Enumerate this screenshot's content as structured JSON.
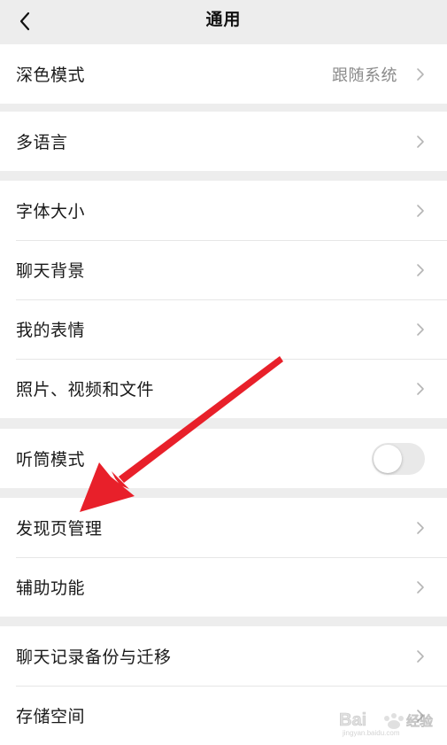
{
  "header": {
    "title": "通用",
    "back_icon": "chevron-left-icon"
  },
  "groups": [
    {
      "rows": [
        {
          "label": "深色模式",
          "value": "跟随系统",
          "type": "link"
        }
      ]
    },
    {
      "rows": [
        {
          "label": "多语言",
          "type": "link"
        }
      ]
    },
    {
      "rows": [
        {
          "label": "字体大小",
          "type": "link"
        },
        {
          "label": "聊天背景",
          "type": "link"
        },
        {
          "label": "我的表情",
          "type": "link"
        },
        {
          "label": "照片、视频和文件",
          "type": "link"
        }
      ]
    },
    {
      "rows": [
        {
          "label": "听筒模式",
          "type": "toggle",
          "toggle_on": false
        }
      ]
    },
    {
      "rows": [
        {
          "label": "发现页管理",
          "type": "link"
        },
        {
          "label": "辅助功能",
          "type": "link"
        }
      ]
    },
    {
      "rows": [
        {
          "label": "聊天记录备份与迁移",
          "type": "link"
        },
        {
          "label": "存储空间",
          "type": "link"
        }
      ]
    }
  ],
  "colors": {
    "background": "#ededed",
    "row_background": "#ffffff",
    "text_primary": "#1a1a1a",
    "text_secondary": "#8a8a8a",
    "annotation_arrow": "#e8202a",
    "toggle_off": "#e9e9e9"
  },
  "annotation": {
    "type": "arrow",
    "points_to": "发现页管理"
  },
  "watermark": {
    "text": "Bai 经验",
    "subtext": "jingyan.baidu.com"
  }
}
